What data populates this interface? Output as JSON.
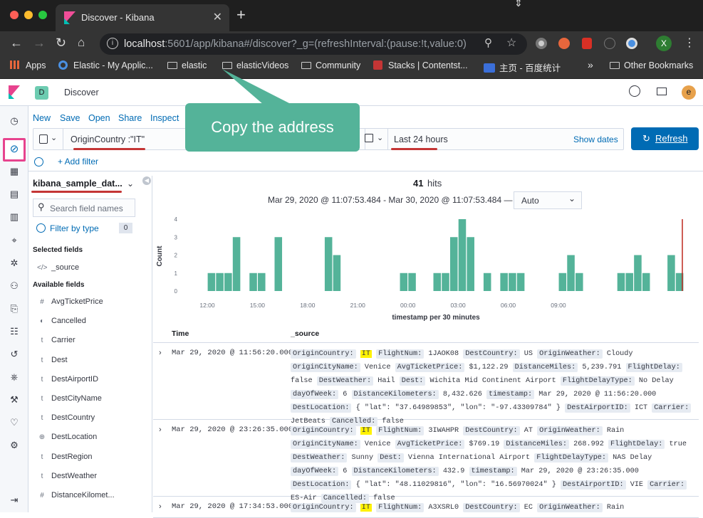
{
  "browser": {
    "tab_title": "Discover - Kibana",
    "url_host": "localhost",
    "url_rest": ":5601/app/kibana#/discover?_g=(refreshInterval:(pause:!t,value:0),ti...",
    "profile_initial": "X",
    "bookmarks": [
      "Apps",
      "Elastic - My Applic...",
      "elastic",
      "elasticVideos",
      "Community",
      "Stacks | Contentst...",
      "主页 - 百度统计",
      "»",
      "Other Bookmarks"
    ]
  },
  "kibana": {
    "space_initial": "D",
    "breadcrumb": "Discover",
    "user_initial": "e",
    "menu": [
      "New",
      "Save",
      "Open",
      "Share",
      "Inspect"
    ],
    "query": "OriginCountry :\"IT\"",
    "time_range": "Last 24 hours",
    "show_dates": "Show dates",
    "refresh_label": "Refresh",
    "add_filter": "+ Add filter",
    "index_pattern": "kibana_sample_dat...",
    "search_placeholder": "Search field names",
    "filter_by_type": "Filter by type",
    "filter_count": "0",
    "selected_fields_heading": "Selected fields",
    "selected_fields": [
      {
        "type": "</>",
        "name": "_source"
      }
    ],
    "available_fields_heading": "Available fields",
    "available_fields": [
      {
        "type": "#",
        "name": "AvgTicketPrice"
      },
      {
        "type": "◐",
        "name": "Cancelled"
      },
      {
        "type": "t",
        "name": "Carrier"
      },
      {
        "type": "t",
        "name": "Dest"
      },
      {
        "type": "t",
        "name": "DestAirportID"
      },
      {
        "type": "t",
        "name": "DestCityName"
      },
      {
        "type": "t",
        "name": "DestCountry"
      },
      {
        "type": "⊕",
        "name": "DestLocation"
      },
      {
        "type": "t",
        "name": "DestRegion"
      },
      {
        "type": "t",
        "name": "DestWeather"
      },
      {
        "type": "#",
        "name": "DistanceKilomet..."
      }
    ]
  },
  "hits": {
    "count": "41",
    "label": "hits",
    "range": "Mar 29, 2020 @ 11:07:53.484 - Mar 30, 2020 @ 11:07:53.484 —",
    "interval": "Auto"
  },
  "chart_data": {
    "type": "bar",
    "ylabel": "Count",
    "xlabel": "timestamp per 30 minutes",
    "ylim": [
      0,
      4
    ],
    "yticks": [
      "0",
      "1",
      "2",
      "3",
      "4"
    ],
    "xticks": [
      "12:00",
      "15:00",
      "18:00",
      "21:00",
      "00:00",
      "03:00",
      "06:00",
      "09:00"
    ],
    "values": [
      1,
      1,
      1,
      3,
      0,
      1,
      1,
      0,
      3,
      0,
      0,
      0,
      0,
      0,
      3,
      2,
      0,
      0,
      0,
      0,
      0,
      0,
      0,
      1,
      1,
      0,
      0,
      1,
      1,
      3,
      4,
      3,
      0,
      1,
      0,
      1,
      1,
      1,
      0,
      0,
      0,
      0,
      1,
      2,
      1,
      0,
      0,
      0,
      0,
      1,
      1,
      2,
      1,
      0,
      0,
      2,
      1
    ],
    "bar_color": "#54b399",
    "now_marker_color": "#bd271e"
  },
  "table": {
    "col_time": "Time",
    "col_source": "_source",
    "rows": [
      {
        "time": "Mar 29, 2020 @ 11:56:20.000",
        "source": [
          [
            "OriginCountry:",
            "IT",
            true
          ],
          [
            "FlightNum:",
            "1JAOK08"
          ],
          [
            "DestCountry:",
            "US"
          ],
          [
            "OriginWeather:",
            "Cloudy"
          ],
          [
            "OriginCityName:",
            "Venice"
          ],
          [
            "AvgTicketPrice:",
            "$1,122.29"
          ],
          [
            "DistanceMiles:",
            "5,239.791"
          ],
          [
            "FlightDelay:",
            "false"
          ],
          [
            "DestWeather:",
            "Hail"
          ],
          [
            "Dest:",
            "Wichita Mid Continent Airport"
          ],
          [
            "FlightDelayType:",
            "No Delay"
          ],
          [
            "dayOfWeek:",
            "6"
          ],
          [
            "DistanceKilometers:",
            "8,432.626"
          ],
          [
            "timestamp:",
            "Mar 29, 2020 @ 11:56:20.000"
          ],
          [
            "DestLocation:",
            "{ \"lat\":"
          ],
          [
            "",
            "\"37.64989853\", \"lon\": \"-97.43309784\" }"
          ],
          [
            "DestAirportID:",
            "ICT"
          ],
          [
            "Carrier:",
            "JetBeats"
          ],
          [
            "Cancelled:",
            "false"
          ]
        ]
      },
      {
        "time": "Mar 29, 2020 @ 23:26:35.000",
        "source": [
          [
            "OriginCountry:",
            "IT",
            true
          ],
          [
            "FlightNum:",
            "3IWAHPR"
          ],
          [
            "DestCountry:",
            "AT"
          ],
          [
            "OriginWeather:",
            "Rain"
          ],
          [
            "OriginCityName:",
            "Venice"
          ],
          [
            "AvgTicketPrice:",
            "$769.19"
          ],
          [
            "DistanceMiles:",
            "268.992"
          ],
          [
            "FlightDelay:",
            "true"
          ],
          [
            "DestWeather:",
            "Sunny"
          ],
          [
            "Dest:",
            "Vienna International Airport"
          ],
          [
            "FlightDelayType:",
            "NAS Delay"
          ],
          [
            "dayOfWeek:",
            "6"
          ],
          [
            "DistanceKilometers:",
            "432.9"
          ],
          [
            "timestamp:",
            "Mar 29, 2020 @ 23:26:35.000"
          ],
          [
            "DestLocation:",
            "{ \"lat\":"
          ],
          [
            "",
            "\"48.11029816\", \"lon\": \"16.56970024\" }"
          ],
          [
            "DestAirportID:",
            "VIE"
          ],
          [
            "Carrier:",
            "ES-Air"
          ],
          [
            "Cancelled:",
            "false"
          ]
        ]
      },
      {
        "time": "Mar 29, 2020 @ 17:34:53.000",
        "source": [
          [
            "OriginCountry:",
            "IT",
            true
          ],
          [
            "FlightNum:",
            "A3XSRL0"
          ],
          [
            "DestCountry:",
            "EC"
          ],
          [
            "OriginWeather:",
            "Rain"
          ]
        ]
      }
    ]
  },
  "overlay_text": "Copy the address",
  "colors": {
    "accent": "#006bb4",
    "annotation": "#54b399",
    "underline": "#c43535",
    "highlight": "#fff200"
  }
}
